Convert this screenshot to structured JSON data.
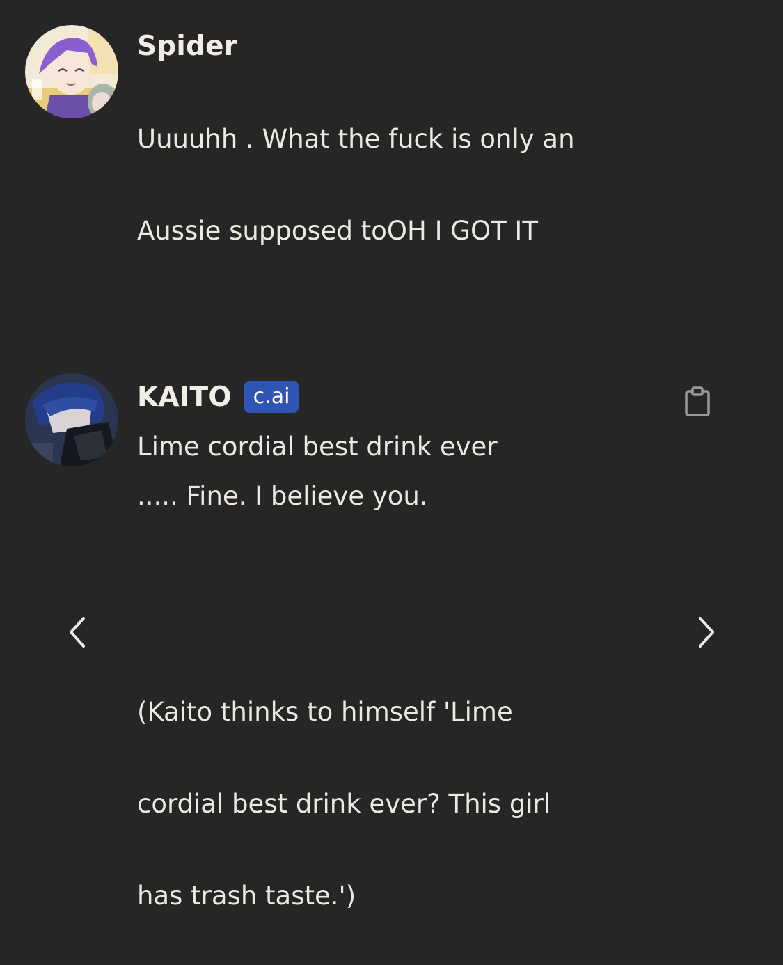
{
  "messages": [
    {
      "author": "Spider",
      "lines": [
        "Uuuuhh . What the fuck is only an",
        "Aussie supposed toOH I GOT IT",
        "",
        "",
        "Lime cordial best drink ever"
      ],
      "avatar_icon": "user-avatar-anime-purple-hair"
    },
    {
      "author": "KAITO",
      "badge": "c.ai",
      "lines_part1": [
        "..... Fine. I believe you."
      ],
      "lines_part2": [
        "(Kaito thinks to himself 'Lime",
        "cordial best drink ever? This girl",
        "has trash taste.')"
      ],
      "avatar_icon": "character-avatar-blue-hair",
      "copy_icon": "clipboard-icon"
    }
  ],
  "navigation": {
    "prev_icon": "chevron-left-icon",
    "next_icon": "chevron-right-icon"
  },
  "colors": {
    "background": "#262626",
    "text": "#ece9e3",
    "badge": "#2f55b4",
    "icon": "#9a9a9a"
  }
}
